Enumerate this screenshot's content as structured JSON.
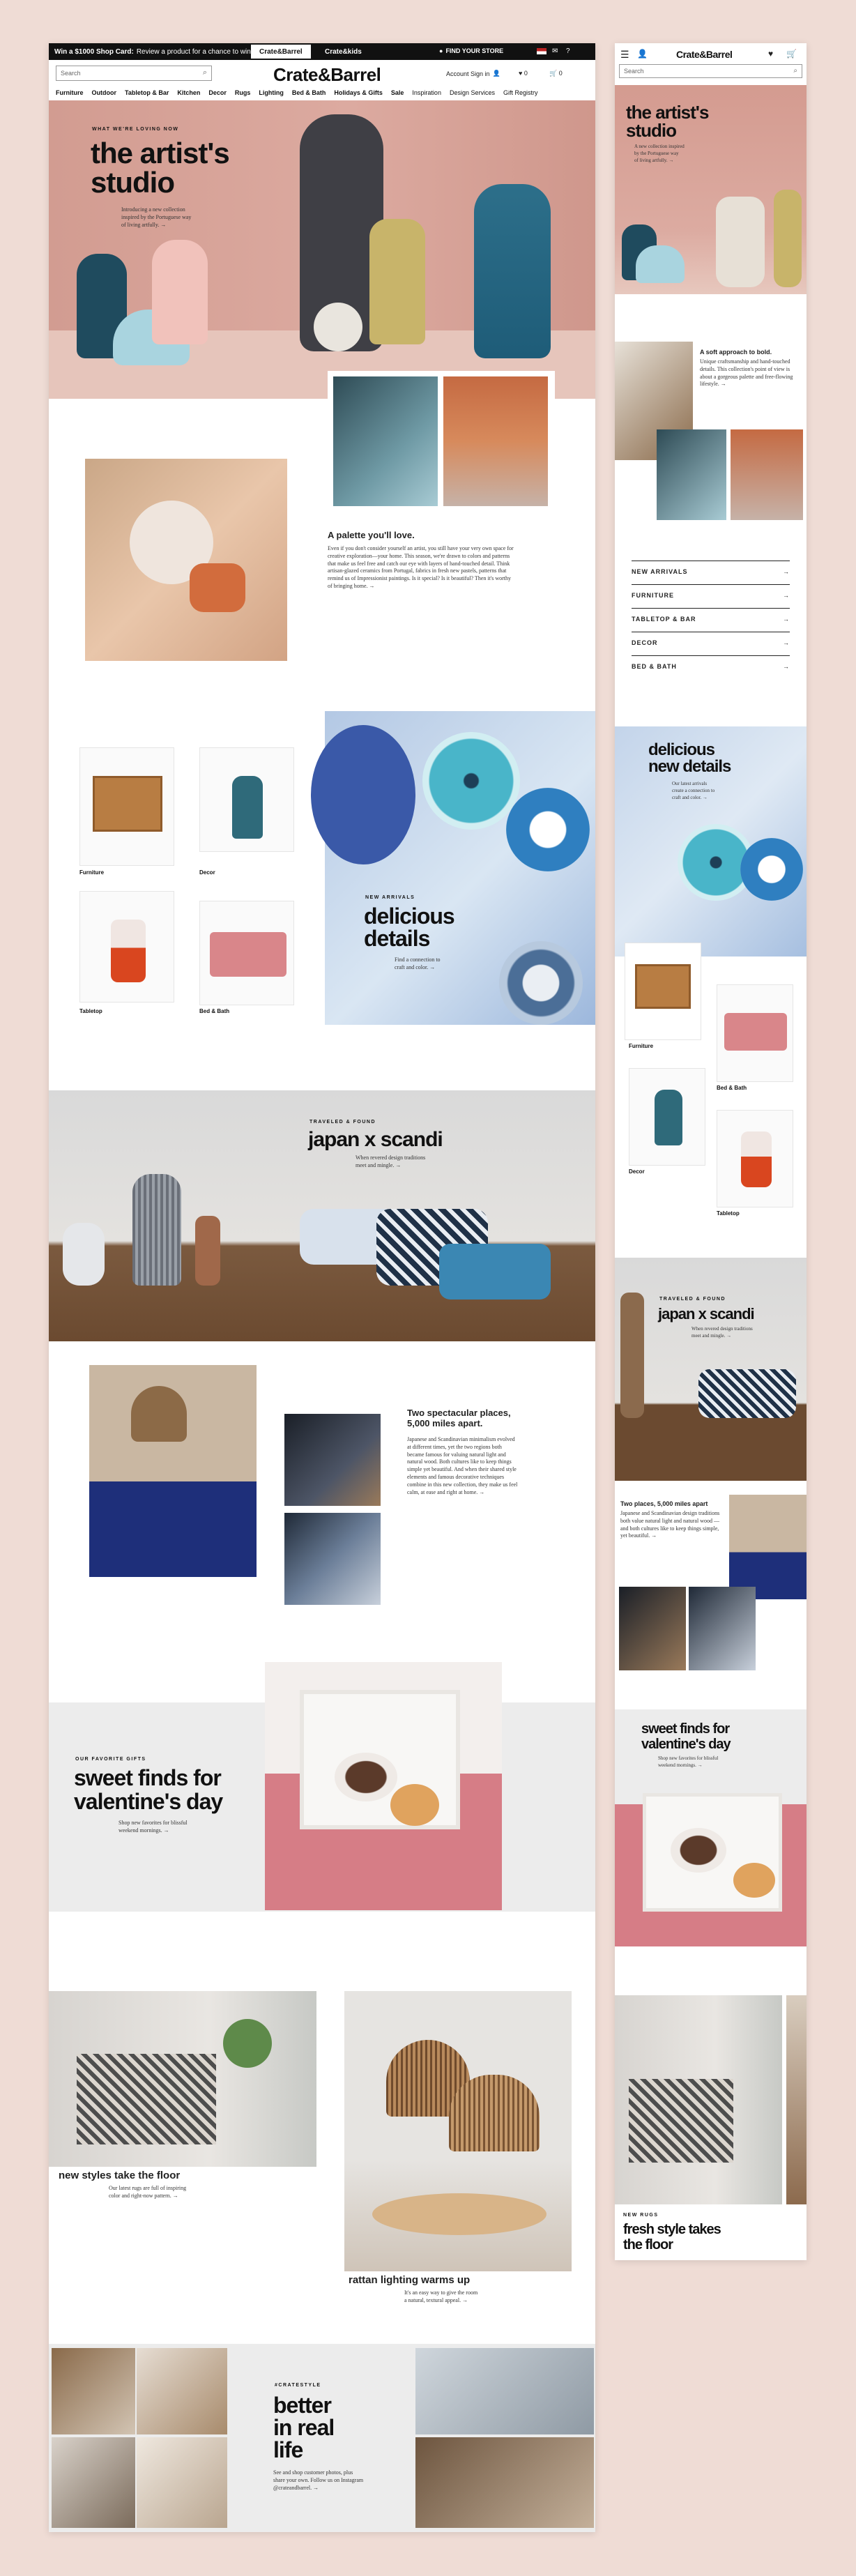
{
  "desktop": {
    "promo": {
      "bold": "Win a $1000 Shop Card:",
      "text": "Review a product for a chance to win."
    },
    "brand_tabs": [
      "Crate&Barrel",
      "Crate&kids"
    ],
    "find_store": "FIND YOUR STORE",
    "search_placeholder": "Search",
    "logo": "Crate&Barrel",
    "account": "Account Sign in",
    "cart_count": "0",
    "fav_count": "0",
    "nav": [
      "Furniture",
      "Outdoor",
      "Tabletop & Bar",
      "Kitchen",
      "Decor",
      "Rugs",
      "Lighting",
      "Bed & Bath",
      "Holidays & Gifts",
      "Sale",
      "Inspiration",
      "Design Services",
      "Gift Registry"
    ],
    "hero": {
      "eyebrow": "WHAT WE'RE LOVING NOW",
      "title_1": "the artist's",
      "title_2": "studio",
      "sub_1": "Introducing a new collection",
      "sub_2": "inspired by the Portuguese way",
      "sub_3": "of living artfully. →"
    },
    "palette": {
      "title": "A palette you'll love.",
      "body": "Even if you don't consider yourself an artist, you still have your very own space for creative exploration—your home. This season, we're drawn to colors and patterns that make us feel free and catch our eye with layers of hand-touched detail. Think artisan-glazed ceramics from Portugal, fabrics in fresh new pastels, patterns that remind us of Impressionist paintings. Is it special? Is it beautiful? Then it's worthy of bringing home. →"
    },
    "categories": [
      "Furniture",
      "Decor",
      "Tabletop",
      "Bed & Bath"
    ],
    "new_arrivals": {
      "eyebrow": "NEW ARRIVALS",
      "title_1": "delicious",
      "title_2": "details",
      "sub_1": "Find a connection to",
      "sub_2": "craft and color. →"
    },
    "japan": {
      "eyebrow": "TRAVELED & FOUND",
      "title": "japan x scandi",
      "sub_1": "When revered design traditions",
      "sub_2": "meet and mingle. →"
    },
    "places": {
      "title_1": "Two spectacular places,",
      "title_2": "5,000 miles apart.",
      "body": "Japanese and Scandinavian minimalism evolved at different times, yet the two regions both became famous for valuing natural light and natural wood. Both cultures like to keep things simple yet beautiful. And when their shared style elements and famous decorative techniques combine in this new collection, they make us feel calm, at ease and right at home. →"
    },
    "valentine": {
      "eyebrow": "OUR FAVORITE GIFTS",
      "title_1": "sweet finds for",
      "title_2": "valentine's day",
      "sub_1": "Shop new favorites for blissful",
      "sub_2": "weekend mornings. →"
    },
    "rugs": {
      "title": "new styles take the floor",
      "sub_1": "Our latest rugs are full of inspiring",
      "sub_2": "color and right-now pattern. →"
    },
    "rattan": {
      "title": "rattan lighting warms up",
      "sub_1": "It's an easy way to give the room",
      "sub_2": "a natural, textural appeal. →"
    },
    "better": {
      "eyebrow": "#CRATESTYLE",
      "title_1": "better",
      "title_2": "in real",
      "title_3": "life",
      "body": "See and shop customer photos, plus share your own. Follow us on Instagram @crateandbarrel. →"
    }
  },
  "mobile": {
    "logo": "Crate&Barrel",
    "search_placeholder": "Search",
    "hero": {
      "title_1": "the artist's",
      "title_2": "studio",
      "sub_1": "A new collection inspired",
      "sub_2": "by the Portuguese way",
      "sub_3": "of living artfully. →"
    },
    "soft": {
      "title": "A soft approach to bold.",
      "body": "Unique craftsmanship and hand-touched details. This collection's point of view is about a gorgeous palette and free-flowing lifestyle. →"
    },
    "links": [
      "NEW ARRIVALS",
      "FURNITURE",
      "TABLETOP & BAR",
      "DECOR",
      "BED & BATH"
    ],
    "delicious": {
      "title_1": "delicious",
      "title_2": "new details",
      "sub_1": "Our latest arrivals",
      "sub_2": "create a connection to",
      "sub_3": "craft and color. →"
    },
    "categories": [
      "Furniture",
      "Bed & Bath",
      "Decor",
      "Tabletop"
    ],
    "japan": {
      "eyebrow": "TRAVELED & FOUND",
      "title": "japan x scandi",
      "sub_1": "When revered design traditions",
      "sub_2": "meet and mingle. →"
    },
    "places": {
      "title": "Two places, 5,000 miles apart",
      "body": "Japanese and Scandinavian design traditions both value natural light and natural wood —and both cultures like to keep things simple, yet beautiful. →"
    },
    "valentine": {
      "title_1": "sweet finds for",
      "title_2": "valentine's day",
      "sub_1": "Shop new favorites for blissful",
      "sub_2": "weekend mornings. →"
    },
    "rugs": {
      "eyebrow": "NEW RUGS",
      "title_1": "fresh style takes",
      "title_2": "the floor"
    }
  },
  "colors": {
    "page_bg": "#efdcd5",
    "hero_pink": "#d9a59b",
    "teal": "#2f6f86",
    "navy": "#1e3a5f",
    "blue_panel": "#b9d6e8"
  }
}
